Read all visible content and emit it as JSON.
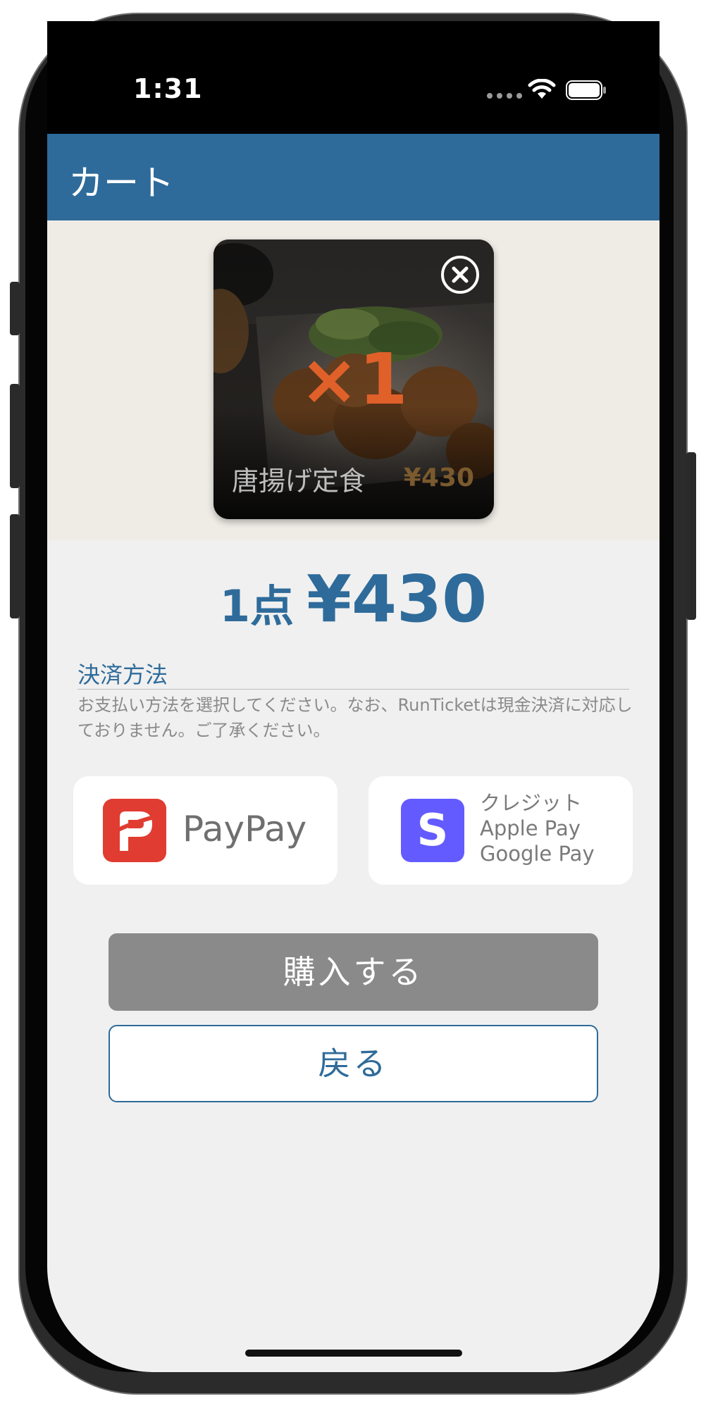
{
  "status_bar": {
    "time": "1:31"
  },
  "nav": {
    "title": "カート"
  },
  "cart_item": {
    "quantity": "×1",
    "name": "唐揚げ定食",
    "price": "¥430"
  },
  "summary": {
    "count": "1点",
    "total": "¥430"
  },
  "payment": {
    "title": "決済方法",
    "description": "お支払い方法を選択してください。なお、RunTicketは現金決済に対応しておりません。ご了承ください。",
    "options": [
      {
        "label": "PayPay",
        "logo_color": "#e03c31"
      },
      {
        "logo_letter": "S",
        "logo_color": "#635bff",
        "lines": [
          "クレジット",
          "Apple Pay",
          "Google Pay"
        ]
      }
    ]
  },
  "actions": {
    "buy_label": "購入する",
    "back_label": "戻る"
  },
  "colors": {
    "accent": "#2e6b9a",
    "quantity": "#e0602a",
    "disabled_button": "#8a8a8a"
  }
}
